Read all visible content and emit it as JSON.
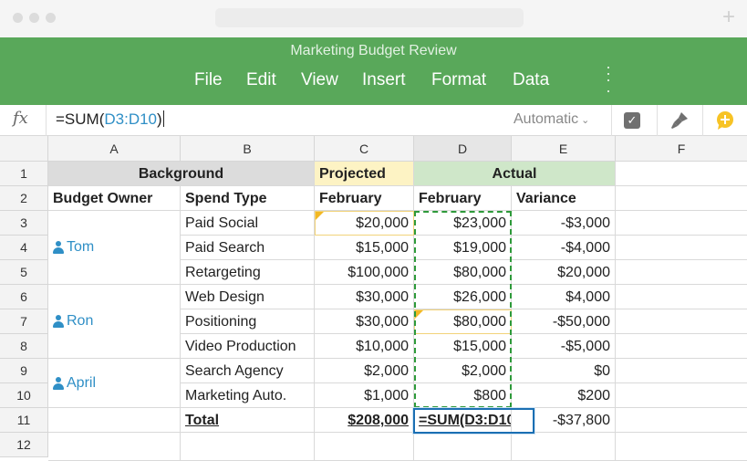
{
  "header": {
    "title": "Marketing Budget Review",
    "menu": [
      "File",
      "Edit",
      "View",
      "Insert",
      "Format",
      "Data"
    ]
  },
  "formula_bar": {
    "fx": "fx",
    "prefix": "=SUM(",
    "ref": "D3:D10",
    "suffix": ")",
    "format": "Automatic"
  },
  "columns": [
    "A",
    "B",
    "C",
    "D",
    "E",
    "F"
  ],
  "rows": [
    "1",
    "2",
    "3",
    "4",
    "5",
    "6",
    "7",
    "8",
    "9",
    "10",
    "11",
    "12"
  ],
  "sheet": {
    "group_headers": {
      "background": "Background",
      "projected": "Projected",
      "actual": "Actual"
    },
    "col_headers": {
      "owner": "Budget Owner",
      "spend": "Spend Type",
      "proj": "February",
      "act": "February",
      "var": "Variance"
    },
    "owners": [
      "Tom",
      "Ron",
      "April"
    ],
    "data": [
      {
        "spend": "Paid Social",
        "proj": "$20,000",
        "act": "$23,000",
        "var": "-$3,000"
      },
      {
        "spend": "Paid Search",
        "proj": "$15,000",
        "act": "$19,000",
        "var": "-$4,000"
      },
      {
        "spend": "Retargeting",
        "proj": "$100,000",
        "act": "$80,000",
        "var": "$20,000"
      },
      {
        "spend": "Web Design",
        "proj": "$30,000",
        "act": "$26,000",
        "var": "$4,000"
      },
      {
        "spend": "Positioning",
        "proj": "$30,000",
        "act": "$80,000",
        "var": "-$50,000"
      },
      {
        "spend": "Video Production",
        "proj": "$10,000",
        "act": "$15,000",
        "var": "-$5,000"
      },
      {
        "spend": "Search Agency",
        "proj": "$2,000",
        "act": "$2,000",
        "var": "$0"
      },
      {
        "spend": "Marketing Auto.",
        "proj": "$1,000",
        "act": "$800",
        "var": "$200"
      }
    ],
    "total": {
      "label": "Total",
      "proj": "$208,000",
      "act": "=SUM(D3:D10)",
      "var": "-$37,800"
    }
  },
  "colors": {
    "header_green": "#59a85a",
    "projected_bg": "#fdf3c4",
    "actual_bg": "#cfe7c9",
    "background_bg": "#dcdcdc",
    "link_blue": "#2f8fc6"
  }
}
